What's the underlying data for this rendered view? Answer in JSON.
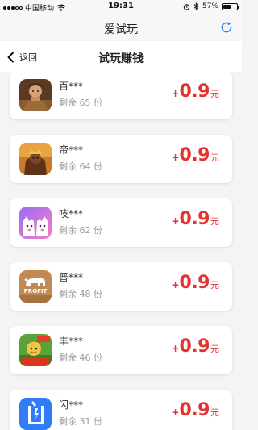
{
  "status_bar": {
    "carrier": "中国移动",
    "time": "19:31",
    "battery_percent": "57%",
    "battery_level": 0.57
  },
  "header": {
    "title": "爱试玩",
    "refresh_icon": "refresh-icon"
  },
  "nav": {
    "back_label": "返回",
    "title": "试玩赚钱"
  },
  "colors": {
    "accent_blue": "#2f7cf6",
    "reward_red": "#e5312f"
  },
  "tasks": [
    {
      "name": "百***",
      "remaining": "剩余 65 份",
      "plus": "+",
      "amount": "0.9",
      "unit": "元",
      "icon": "warrior-game-icon"
    },
    {
      "name": "帝***",
      "remaining": "剩余 64 份",
      "plus": "+",
      "amount": "0.9",
      "unit": "元",
      "icon": "emperor-game-icon"
    },
    {
      "name": "吱***",
      "remaining": "剩余 62 份",
      "plus": "+",
      "amount": "0.9",
      "unit": "元",
      "icon": "cartoon-ghosts-icon"
    },
    {
      "name": "普***",
      "remaining": "剩余 48 份",
      "plus": "+",
      "amount": "0.9",
      "unit": "元",
      "icon": "profit-bull-icon",
      "icon_text": "PROFIT"
    },
    {
      "name": "丰***",
      "remaining": "剩余 46 份",
      "plus": "+",
      "amount": "0.9",
      "unit": "元",
      "icon": "farm-game-icon"
    },
    {
      "name": "闪***",
      "remaining": "剩余 31 份",
      "plus": "+",
      "amount": "0.9",
      "unit": "元",
      "icon": "flash-logo-icon"
    }
  ]
}
